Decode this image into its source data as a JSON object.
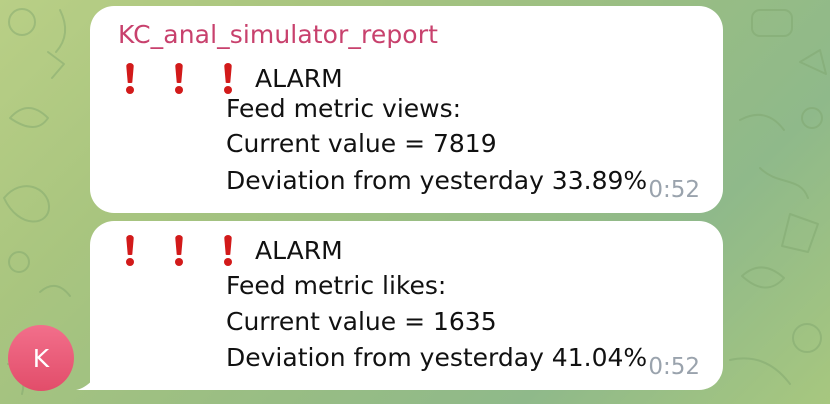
{
  "chat": {
    "sender_name": "KC_anal_simulator_report",
    "avatar_initial": "K",
    "messages": [
      {
        "alarm_icons": [
          "exclamation-icon",
          "exclamation-icon",
          "exclamation-icon"
        ],
        "alarm_label": "ALARM",
        "metric_line": "Feed metric views:",
        "current_line": "Current value = 7819",
        "deviation_line": "Deviation from yesterday 33.89%",
        "time": "0:52"
      },
      {
        "alarm_icons": [
          "exclamation-icon",
          "exclamation-icon",
          "exclamation-icon"
        ],
        "alarm_label": "ALARM",
        "metric_line": "Feed metric likes:",
        "current_line": "Current value = 1635",
        "deviation_line": "Deviation from yesterday 41.04%",
        "time": "0:52"
      }
    ]
  },
  "colors": {
    "sender_name": "#c8416d",
    "alarm_icon": "#d21a1a",
    "avatar": "#e85a77",
    "timestamp": "#9aa3ad",
    "bubble": "#ffffff"
  }
}
